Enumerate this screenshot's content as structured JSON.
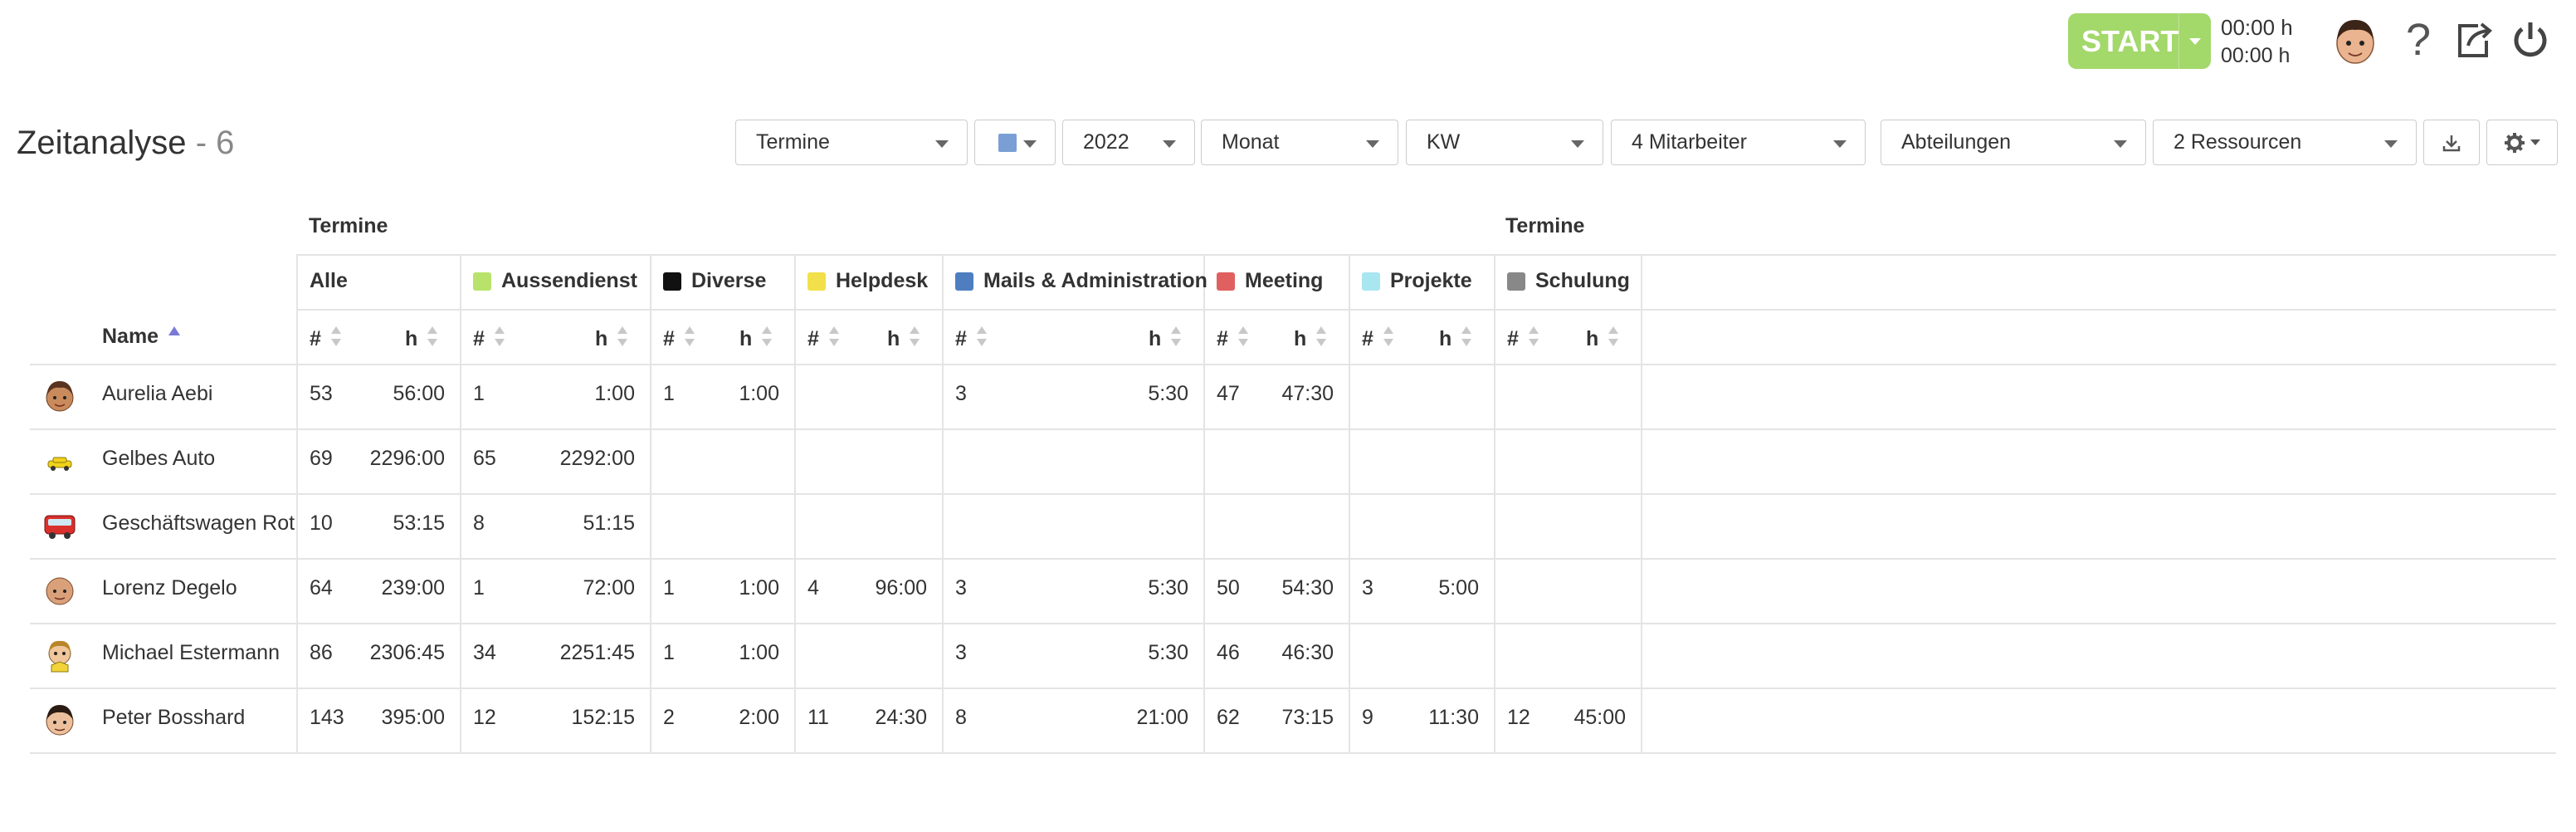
{
  "topbar": {
    "start_label": "START",
    "timer_today": "00:00 h",
    "timer_week": "00:00 h",
    "icons": [
      "user-avatar-icon",
      "help-icon",
      "logout-icon",
      "power-icon"
    ]
  },
  "page": {
    "title": "Zeitanalyse",
    "count_label": "- 6"
  },
  "toolbar": {
    "type_value": "Termine",
    "color_value": "#7b9fd4",
    "year_value": "2022",
    "period_value": "Monat",
    "week_value": "KW",
    "employees_value": "4 Mitarbeiter",
    "departments_value": "Abteilungen",
    "resources_value": "2 Ressourcen",
    "download_icon": "download-icon",
    "settings_icon": "gear-icon"
  },
  "table": {
    "group_label_left": "Termine",
    "group_label_right": "Termine",
    "name_header": "Name",
    "count_header": "#",
    "hours_header": "h",
    "categories": [
      {
        "label": "Alle",
        "color": ""
      },
      {
        "label": "Aussendienst",
        "color": "#b8e26b"
      },
      {
        "label": "Diverse",
        "color": "#111111"
      },
      {
        "label": "Helpdesk",
        "color": "#f2e04a"
      },
      {
        "label": "Mails & Administration",
        "color": "#4e7ec0"
      },
      {
        "label": "Meeting",
        "color": "#e06060"
      },
      {
        "label": "Projekte",
        "color": "#a8e6f0"
      },
      {
        "label": "Schulung",
        "color": "#888888"
      }
    ],
    "rows": [
      {
        "name": "Aurelia Aebi",
        "avatar": "woman-avatar-icon",
        "cells": [
          [
            "53",
            "56:00"
          ],
          [
            "1",
            "1:00"
          ],
          [
            "1",
            "1:00"
          ],
          [
            "",
            ""
          ],
          [
            "3",
            "5:30"
          ],
          [
            "47",
            "47:30"
          ],
          [
            "",
            ""
          ],
          [
            "",
            ""
          ]
        ]
      },
      {
        "name": "Gelbes Auto",
        "avatar": "yellow-car-icon",
        "cells": [
          [
            "69",
            "2296:00"
          ],
          [
            "65",
            "2292:00"
          ],
          [
            "",
            ""
          ],
          [
            "",
            ""
          ],
          [
            "",
            ""
          ],
          [
            "",
            ""
          ],
          [
            "",
            ""
          ],
          [
            "",
            ""
          ]
        ]
      },
      {
        "name": "Geschäftswagen Rot",
        "avatar": "red-bus-icon",
        "cells": [
          [
            "10",
            "53:15"
          ],
          [
            "8",
            "51:15"
          ],
          [
            "",
            ""
          ],
          [
            "",
            ""
          ],
          [
            "",
            ""
          ],
          [
            "",
            ""
          ],
          [
            "",
            ""
          ],
          [
            "",
            ""
          ]
        ]
      },
      {
        "name": "Lorenz Degelo",
        "avatar": "man-bald-avatar-icon",
        "cells": [
          [
            "64",
            "239:00"
          ],
          [
            "1",
            "72:00"
          ],
          [
            "1",
            "1:00"
          ],
          [
            "4",
            "96:00"
          ],
          [
            "3",
            "5:30"
          ],
          [
            "50",
            "54:30"
          ],
          [
            "3",
            "5:00"
          ],
          [
            "",
            ""
          ]
        ]
      },
      {
        "name": "Michael Estermann",
        "avatar": "boy-avatar-icon",
        "cells": [
          [
            "86",
            "2306:45"
          ],
          [
            "34",
            "2251:45"
          ],
          [
            "1",
            "1:00"
          ],
          [
            "",
            ""
          ],
          [
            "3",
            "5:30"
          ],
          [
            "46",
            "46:30"
          ],
          [
            "",
            ""
          ],
          [
            "",
            ""
          ]
        ]
      },
      {
        "name": "Peter Bosshard",
        "avatar": "man-dark-hair-avatar-icon",
        "cells": [
          [
            "143",
            "395:00"
          ],
          [
            "12",
            "152:15"
          ],
          [
            "2",
            "2:00"
          ],
          [
            "11",
            "24:30"
          ],
          [
            "8",
            "21:00"
          ],
          [
            "62",
            "73:15"
          ],
          [
            "9",
            "11:30"
          ],
          [
            "12",
            "45:00"
          ]
        ]
      }
    ]
  }
}
